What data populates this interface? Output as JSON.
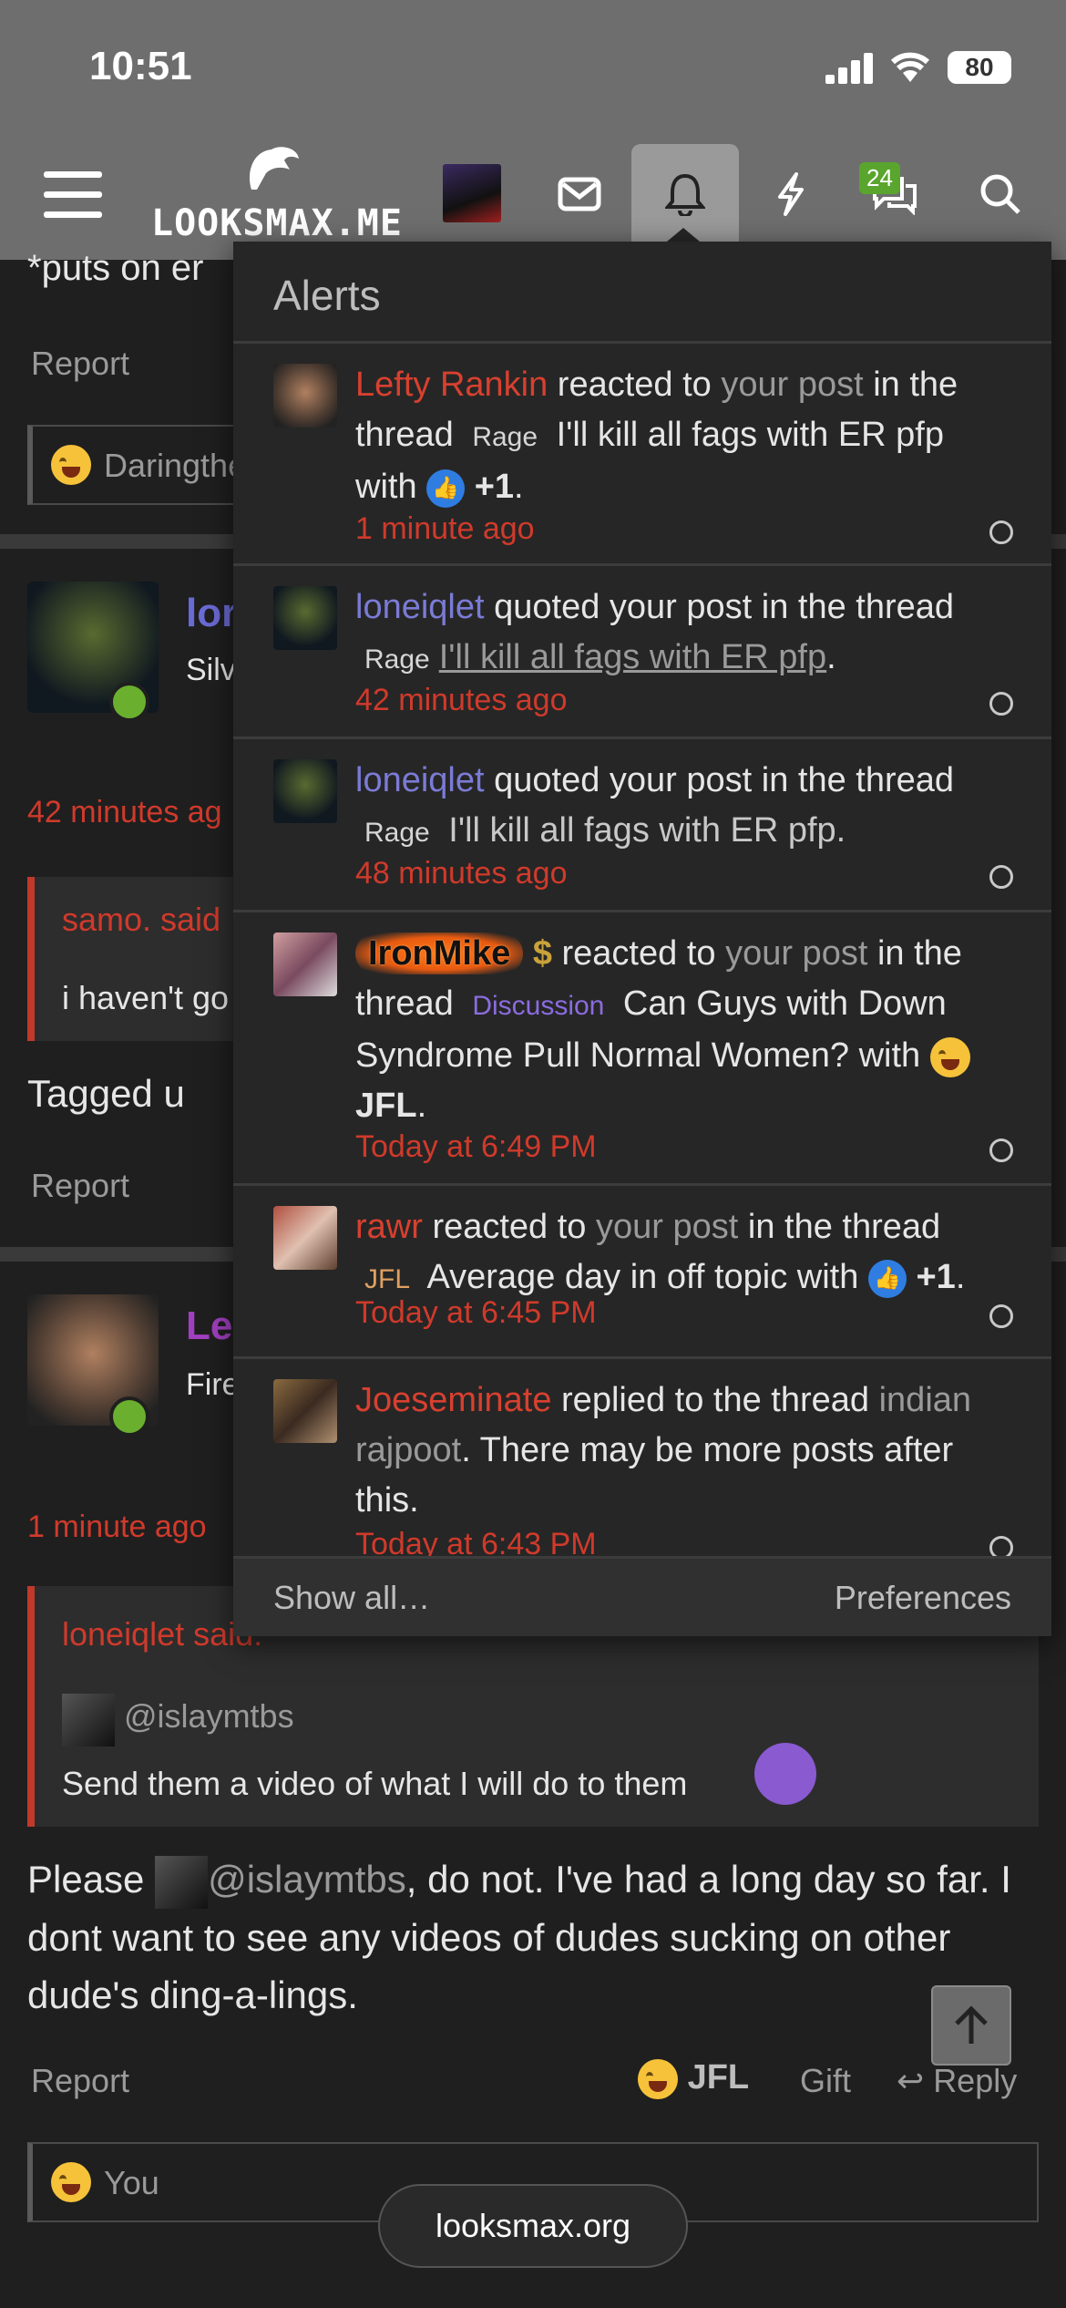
{
  "status_bar": {
    "time": "10:51",
    "battery": "80"
  },
  "nav": {
    "logo": "LOOKSMAX.ME",
    "chat_badge": "24",
    "icons": [
      "menu-icon",
      "avatar",
      "mail-icon",
      "bell-icon",
      "lightning-icon",
      "chat-icon",
      "search-icon"
    ]
  },
  "background_posts": {
    "top_snippet": "*puts on er",
    "report1": "Report",
    "react1": "Daringthe",
    "post2_user": "lor",
    "post2_title": "Silv",
    "post2_time": "42 minutes ag",
    "post2_quote_author": "samo. said",
    "post2_quote_text": "i haven't go",
    "post2_body": "Tagged u",
    "report2": "Report",
    "post3_user": "Le",
    "post3_title": "Fire",
    "post3_time": "1 minute ago",
    "post3_quote_author": "loneiqlet said:",
    "post3_inner_user": "@islaymtbs",
    "post3_inner_text": "Send them a video of what I will do to them",
    "post3_body_pre": "Please ",
    "post3_body_mention": "@islaymtbs",
    "post3_body_post": ", do not. I've had a long day so far. I dont want to see any videos of dudes sucking on other dude's ding-a-lings.",
    "report3": "Report",
    "reaction_jfl": "JFL",
    "gift": "Gift",
    "reply": "Reply",
    "react3": "You"
  },
  "alerts": {
    "title": "Alerts",
    "items": [
      {
        "user": "Lefty Rankin",
        "t1": " reacted to ",
        "link": "your post",
        "t2": " in the thread ",
        "prefix": "Rage",
        "thread": " I'll kill all fags with ER pfp with ",
        "reaction": "+1",
        "end": ".",
        "time": "1 minute ago"
      },
      {
        "user": "loneiqlet",
        "t1": " quoted your post in the thread ",
        "prefix": "Rage",
        "thread": "I'll kill all fags with ER pfp",
        "end": ".",
        "time": "42 minutes ago"
      },
      {
        "user": "loneiqlet",
        "t1": " quoted your post in the thread ",
        "prefix": "Rage",
        "thread": " I'll kill all fags with ER pfp.",
        "time": "48 minutes ago"
      },
      {
        "user": "IronMike",
        "symbol": "$",
        "t1": " reacted to ",
        "link": "your post",
        "t2": " in the thread ",
        "prefix": "Discussion",
        "thread": " Can Guys with Down Syndrome Pull Normal Women? with ",
        "reaction": "JFL",
        "end": ".",
        "time": "Today at 6:49 PM"
      },
      {
        "user": "rawr",
        "t1": " reacted to ",
        "link": "your post",
        "t2": " in the thread ",
        "prefix": "JFL",
        "thread": " Average day in off topic with ",
        "reaction": "+1",
        "end": ".",
        "time": "Today at 6:45 PM"
      },
      {
        "user": "Joeseminate",
        "t1": " replied to the thread ",
        "link": "indian rajpoot",
        "t2": ". There may be more posts after this.",
        "time": "Today at 6:43 PM"
      }
    ],
    "show_all": "Show all…",
    "preferences": "Preferences"
  },
  "footer": {
    "site": "looksmax.org"
  }
}
